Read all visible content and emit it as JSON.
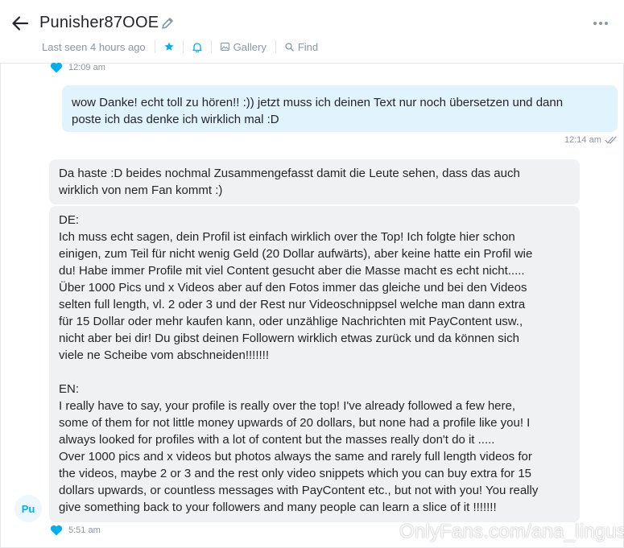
{
  "header": {
    "title": "Punisher87OOE",
    "last_seen": "Last seen 4 hours ago",
    "gallery_label": "Gallery",
    "find_label": "Find"
  },
  "messages": [
    {
      "timestamp": "12:09 am"
    },
    {
      "text": "wow Danke! echt toll zu hören!! :)) jetzt muss ich deinen Text nur noch übersetzen und dann\nposte ich das denke ich wirklich mal :D",
      "timestamp": "12:14 am"
    },
    {
      "text": "Da haste :D beides nochmal Zusammengefasst damit die Leute sehen, dass das auch\nwirklich von nem Fan kommt :)"
    },
    {
      "text": "DE:\nIch muss echt sagen, dein Profil ist einfach wirklich over the Top! Ich folgte hier schon\neinigen, zum Teil für nicht wenig Geld (20 Dollar aufwärts), aber keine hatte ein Profil wie\ndu! Habe immer Profile mit viel Content gesucht aber die Masse macht es echt nicht.....\nÜber 1000 Pics und x Videos aber auf den Fotos immer das gleiche und bei den Videos\nselten full length, vl. 2 oder 3 und der Rest nur Videoschnippsel welche man dann extra\nfür 15 Dollar oder mehr kaufen kann, oder unzählige Nachrichten mit PayContent usw.,\nnicht aber bei dir! Du gibst deinen Followern wirklich etwas zurück und da können sich\nviele ne Scheibe vom abschneiden!!!!!!!\n\nEN:\nI really have to say, your profile is really over the top! I've already followed a few here,\nsome of them for not little money upwards of 20 dollars, but none had a profile like you! I\nalways looked for profiles with a lot of content but the masses really don't do it .....\nOver 1000 pics and x videos but photos always the same and rarely full length videos for\nthe videos, maybe 2 or 3 and the rest only video snippets which you can buy extra for 15\ndollars upwards, or countless messages with PayContent etc., but not with you! You really\ngive something back to your followers and many people can learn a slice of it !!!!!!!",
      "timestamp": "5:51 am"
    }
  ],
  "avatar_initials": "Pu",
  "watermark": "OnlyFans.com/ana_lingus",
  "colors": {
    "accent": "#00aff0",
    "muted": "#8a96a3",
    "outgoing_bubble": "#e1f3fc",
    "incoming_bubble": "#f0f1f3"
  }
}
